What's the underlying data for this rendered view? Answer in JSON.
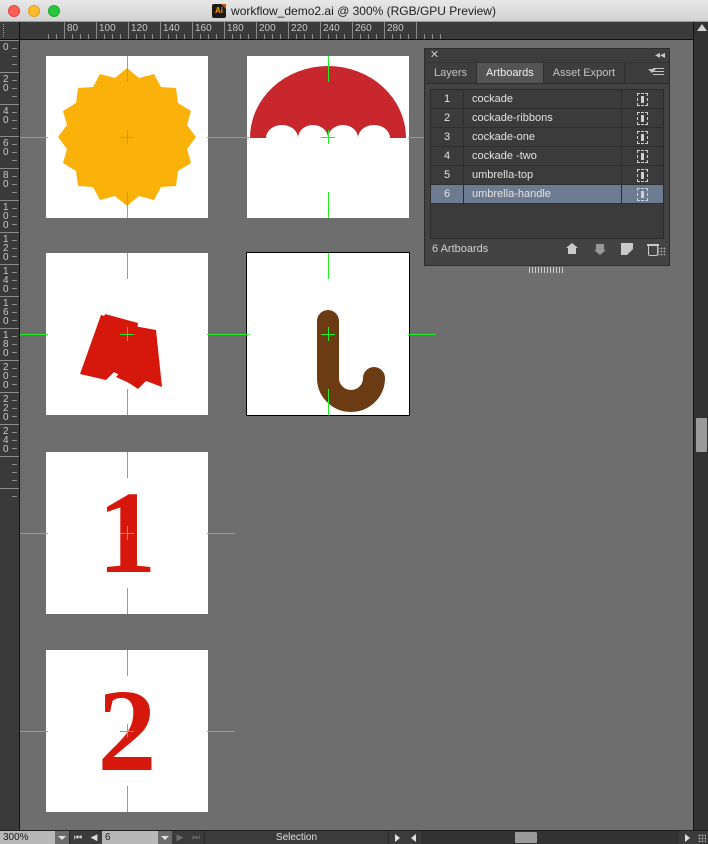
{
  "window": {
    "title": "workflow_demo2.ai @ 300% (RGB/GPU Preview)",
    "app_icon": "illustrator-icon",
    "controls": {
      "close": "close-window",
      "minimize": "minimize-window",
      "zoom": "zoom-window"
    }
  },
  "rulers": {
    "horizontal_labels": [
      "80",
      "100",
      "120",
      "140",
      "160",
      "180",
      "200",
      "220",
      "240",
      "260",
      "280"
    ],
    "vertical_labels": [
      "0",
      "20",
      "40",
      "60",
      "80",
      "100",
      "120",
      "140",
      "160",
      "180",
      "200",
      "220",
      "240"
    ],
    "unit_spacing_px": 32
  },
  "panel": {
    "close_icon": "close-icon",
    "collapse_icon": "collapse-panel-icon",
    "menu_icon": "panel-menu-icon",
    "tabs": [
      {
        "label": "Layers",
        "active": false
      },
      {
        "label": "Artboards",
        "active": true
      },
      {
        "label": "Asset Export",
        "active": false
      }
    ],
    "artboards": [
      {
        "num": "1",
        "name": "cockade",
        "selected": false
      },
      {
        "num": "2",
        "name": "cockade-ribbons",
        "selected": false
      },
      {
        "num": "3",
        "name": "cockade-one",
        "selected": false
      },
      {
        "num": "4",
        "name": "cockade -two",
        "selected": false
      },
      {
        "num": "5",
        "name": "umbrella-top",
        "selected": false
      },
      {
        "num": "6",
        "name": "umbrella-handle",
        "selected": true
      }
    ],
    "footer": {
      "count_label": "6 Artboards",
      "move_up_icon": "arrow-up-icon",
      "move_down_icon": "arrow-down-icon",
      "new_artboard_icon": "new-artboard-icon",
      "delete_icon": "trash-icon",
      "resize_grip_icon": "resize-grip-icon"
    }
  },
  "statusbar": {
    "zoom_value": "300%",
    "zoom_dropdown_icon": "chevron-down-icon",
    "first_artboard_icon": "first-artboard-icon",
    "prev_artboard_icon": "prev-artboard-icon",
    "artboard_value": "6",
    "artboard_dropdown_icon": "chevron-down-icon",
    "next_artboard_icon": "next-artboard-icon",
    "last_artboard_icon": "last-artboard-icon",
    "tool_label": "Selection",
    "tool_menu_icon": "chevron-right-icon",
    "scroll_left_icon": "chevron-left-icon",
    "scroll_right_icon": "chevron-right-icon",
    "corner_grip_icon": "resize-grip-icon"
  },
  "colors": {
    "canvas_bg": "#6e6e6e",
    "artboard_bg": "#ffffff",
    "guide_green": "#22ee22",
    "cockade_orange": "#fab20b",
    "umbrella_red": "#c8282d",
    "ribbon_red": "#d6170c",
    "handle_brown": "#6b3c13",
    "panel_bg": "#434343",
    "row_selected": "#6d7b90"
  },
  "artwork": [
    {
      "name": "cockade",
      "shape": "scalloped-cockade",
      "color": "#fab20b",
      "selected": false
    },
    {
      "name": "umbrella-top",
      "shape": "umbrella-canopy",
      "color": "#c8282d",
      "selected": false
    },
    {
      "name": "cockade-ribbons",
      "shape": "ribbons",
      "color": "#d6170c",
      "selected": false
    },
    {
      "name": "umbrella-handle",
      "shape": "j-handle",
      "color": "#6b3c13",
      "selected": true
    },
    {
      "name": "cockade-one",
      "shape": "numeral-1",
      "color": "#d6170c",
      "selected": false
    },
    {
      "name": "cockade-two",
      "shape": "numeral-2",
      "color": "#d6170c",
      "selected": false
    }
  ]
}
